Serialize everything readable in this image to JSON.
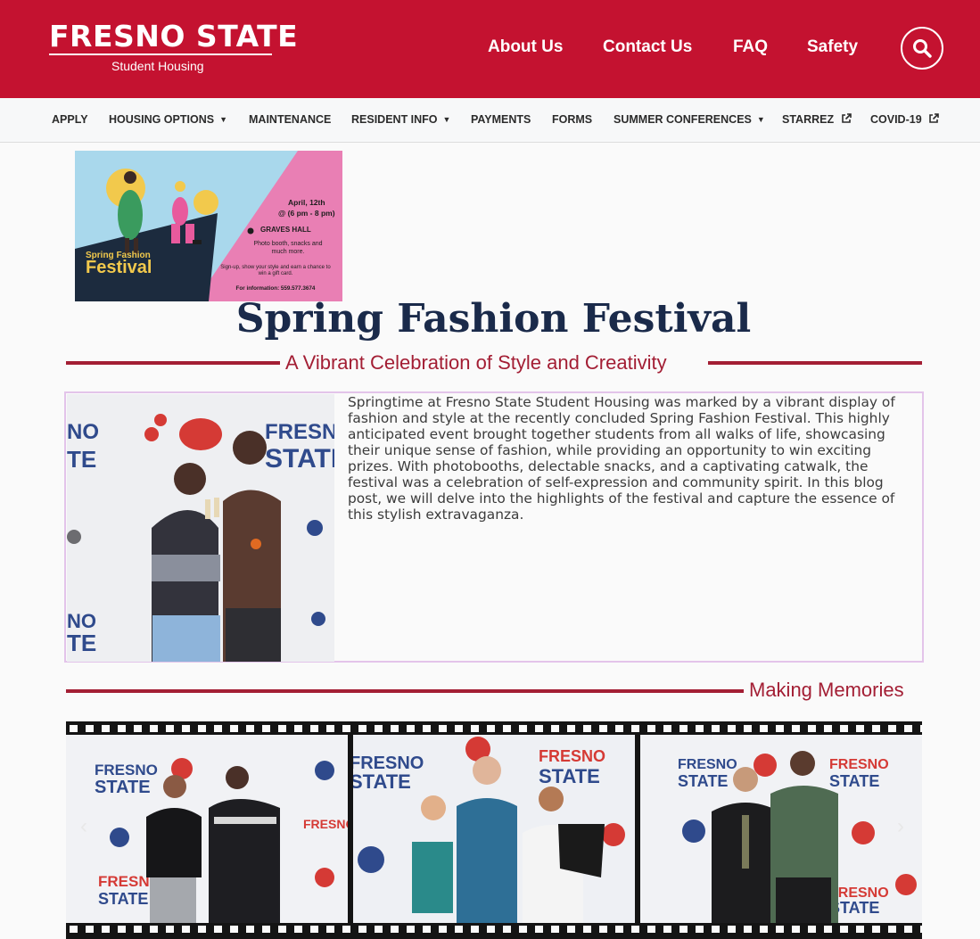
{
  "header": {
    "logo_text": "FRESNO STATE",
    "logo_subtitle": "Student Housing",
    "links": [
      "About Us",
      "Contact Us",
      "FAQ",
      "Safety"
    ],
    "search_icon": "search-icon",
    "brand_color": "#c41230"
  },
  "nav": {
    "items": [
      {
        "label": "APPLY"
      },
      {
        "label": "HOUSING OPTIONS",
        "dropdown": true
      },
      {
        "label": "MAINTENANCE"
      },
      {
        "label": "RESIDENT INFO",
        "dropdown": true
      },
      {
        "label": "PAYMENTS"
      },
      {
        "label": "FORMS"
      },
      {
        "label": "SUMMER CONFERENCES",
        "dropdown": true
      },
      {
        "label": "STARREZ",
        "external": true
      },
      {
        "label": "COVID-19",
        "external": true
      }
    ]
  },
  "banner": {
    "date": "April, 12th",
    "time": "@ (6 pm - 8 pm)",
    "location": "GRAVES HALL",
    "extras": "Photo booth, snacks and much more.",
    "signup": "Sign-up, show your style and earn a chance to win a gift card.",
    "info": "For information: 559.577.3674",
    "title_small": "Spring Fashion",
    "title_large": "Festival"
  },
  "page": {
    "title": "Spring Fashion Festival",
    "subtitle": "A Vibrant Celebration of Style and Creativity",
    "intro": "Springtime at Fresno State Student Housing was marked by a vibrant display of fashion and style at the recently concluded Spring Fashion Festival. This highly anticipated event brought together students from all walks of life, showcasing their unique sense of fashion, while providing an opportunity to win exciting prizes. With photobooths, delectable snacks, and a captivating catwalk, the festival was a celebration of self-expression and community spirit. In this blog post, we will delve into the highlights of the festival and capture the essence of this stylish extravaganza.",
    "section2_heading": "Making Memories",
    "accent_color": "#a31e34",
    "title_color": "#1a2a4a"
  },
  "carousel": {
    "prev_icon": "chevron-left-icon",
    "next_icon": "chevron-right-icon"
  }
}
